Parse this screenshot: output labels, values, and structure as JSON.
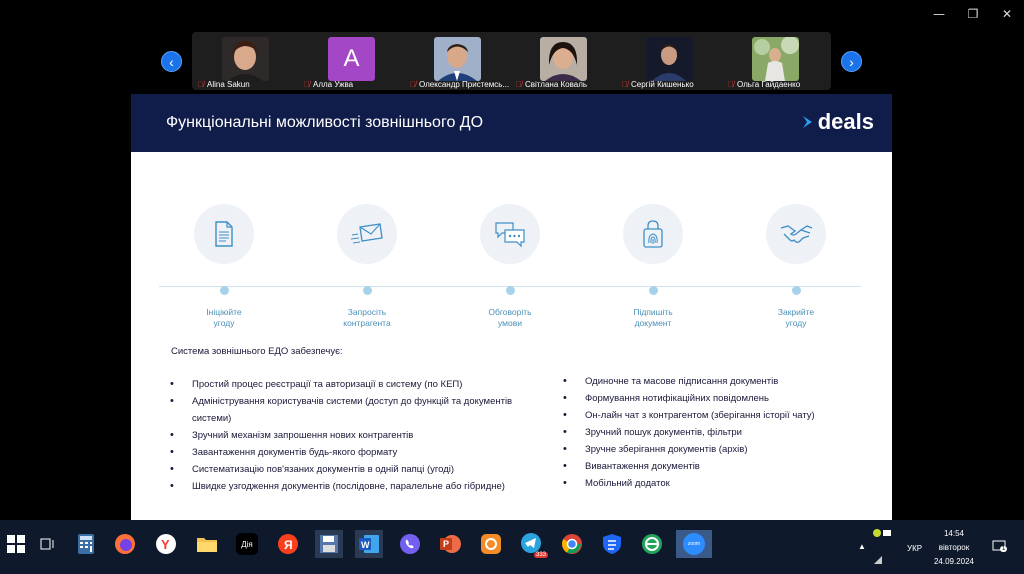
{
  "window": {
    "controls": [
      "—",
      "❐",
      "✕"
    ]
  },
  "participants": [
    {
      "name": "Alina Sakun",
      "avatar": "photo",
      "color": "#5a2b20"
    },
    {
      "name": "Алла Ужва",
      "avatar": "A",
      "color": "#a347c7"
    },
    {
      "name": "Олександр Пристемсь...",
      "avatar": "photo",
      "color": "#2c5aa0"
    },
    {
      "name": "Світлана Коваль",
      "avatar": "photo",
      "color": "#6a4a3a"
    },
    {
      "name": "Сергій Кишенько",
      "avatar": "photo",
      "color": "#1e2a44"
    },
    {
      "name": "Ольга Гайдаенко",
      "avatar": "photo",
      "color": "#6c8a4a"
    }
  ],
  "slide": {
    "title": "Функціональні можливості зовнішнього ДО",
    "logo_text": "deals",
    "steps": [
      {
        "label_line1": "Ініціюйте",
        "label_line2": "угоду",
        "icon": "document-icon"
      },
      {
        "label_line1": "Запросіть",
        "label_line2": "контрагента",
        "icon": "envelope-icon"
      },
      {
        "label_line1": "Обговоріть",
        "label_line2": "умови",
        "icon": "chat-icon"
      },
      {
        "label_line1": "Підпишіть",
        "label_line2": "документ",
        "icon": "fingerprint-lock-icon"
      },
      {
        "label_line1": "Закрийте",
        "label_line2": "угоду",
        "icon": "handshake-icon"
      }
    ],
    "intro": "Система зовнішнього ЕДО забезпечує:",
    "left_list": [
      "Простий процес реєстрації та авторизації в систему (по КЕП)",
      "Адміністрування користувачів системи (доступ до функцій та документів",
      "системи)",
      "Зручний механізм запрошення нових контрагентів",
      "Завантаження документів будь-якого формату",
      "Систематизацію пов'язаних документів в одній папці (угоді)",
      "Швидке узгодження документів (послідовне, паралельне або гібридне)"
    ],
    "right_list": [
      "Одиночне та масове підписання документів",
      "Формування нотифікаційних повідомлень",
      "Он-лайн чат з контрагентом (зберігання історії чату)",
      "Зручний пошук документів, фільтри",
      "Зручне зберігання документів (архів)",
      "Вивантаження документів",
      "Мобільний додаток"
    ]
  },
  "taskbar": {
    "apps": [
      "calculator-icon",
      "firefox-icon",
      "yandex-browser-icon",
      "file-explorer-icon",
      "diia-icon",
      "yandex-icon",
      "save-icon",
      "word-icon",
      "viber-icon",
      "powerpoint-icon",
      "orange-app-icon",
      "telegram-icon",
      "chrome-icon",
      "shield-app-icon",
      "green-app-icon",
      "zoom-icon"
    ],
    "diia_label": "Дія",
    "telegram_badge": "333",
    "zoom_label": "zoom",
    "lang": "УКР",
    "time": "14:54",
    "day": "вівторок",
    "date": "24.09.2024",
    "notif_count": "1"
  }
}
